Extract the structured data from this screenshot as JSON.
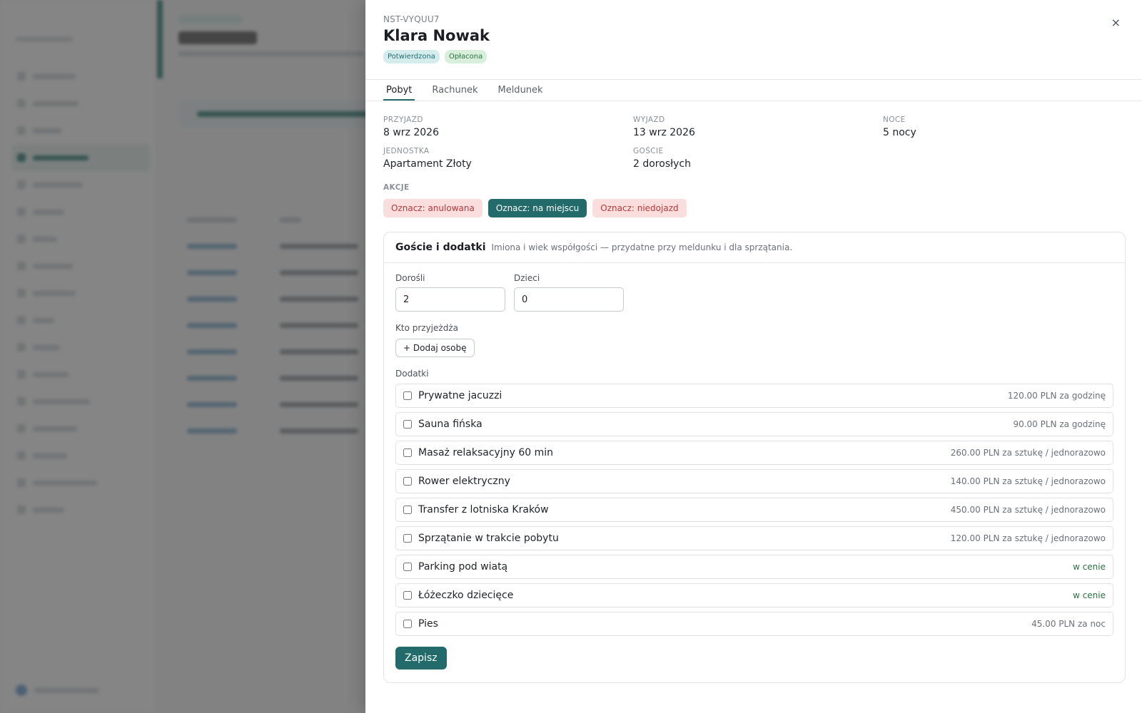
{
  "reservation": {
    "code": "NST-VYQUU7",
    "guest_name": "Klara Nowak",
    "badges": [
      "Potwierdzona",
      "Opłacona"
    ]
  },
  "tabs": [
    "Pobyt",
    "Rachunek",
    "Meldunek"
  ],
  "stay": {
    "arrival_label": "PRZYJAZD",
    "arrival_value": "8 wrz 2026",
    "departure_label": "WYJAZD",
    "departure_value": "13 wrz 2026",
    "nights_label": "NOCE",
    "nights_value": "5 nocy",
    "unit_label": "JEDNOSTKA",
    "unit_value": "Apartament Złoty",
    "guests_label": "GOŚCIE",
    "guests_value": "2 dorosłych"
  },
  "actions": {
    "label": "AKCJE",
    "cancel": "Oznacz: anulowana",
    "on_site": "Oznacz: na miejscu",
    "no_show": "Oznacz: niedojazd"
  },
  "guests_card": {
    "title": "Goście i dodatki",
    "subtitle": "Imiona i wiek współgości — przydatne przy meldunku i dla sprzątania.",
    "adults_label": "Dorośli",
    "adults_value": "2",
    "children_label": "Dzieci",
    "children_value": "0",
    "who_label": "Kto przyjeżdża",
    "add_person": "+ Dodaj osobę",
    "extras_label": "Dodatki",
    "extras": [
      {
        "name": "Prywatne jacuzzi",
        "price": "120.00 PLN za godzinę",
        "checked": false
      },
      {
        "name": "Sauna fińska",
        "price": "90.00 PLN za godzinę",
        "checked": false
      },
      {
        "name": "Masaż relaksacyjny 60 min",
        "price": "260.00 PLN za sztukę / jednorazowo",
        "checked": false
      },
      {
        "name": "Rower elektryczny",
        "price": "140.00 PLN za sztukę / jednorazowo",
        "checked": false
      },
      {
        "name": "Transfer z lotniska Kraków",
        "price": "450.00 PLN za sztukę / jednorazowo",
        "checked": false
      },
      {
        "name": "Sprzątanie w trakcie pobytu",
        "price": "120.00 PLN za sztukę / jednorazowo",
        "checked": false
      },
      {
        "name": "Parking pod wiatą",
        "price": "w cenie",
        "checked": false
      },
      {
        "name": "Łóżeczko dziecięce",
        "price": "w cenie",
        "checked": false
      },
      {
        "name": "Pies",
        "price": "45.00 PLN za noc",
        "checked": false
      }
    ],
    "save": "Zapisz"
  },
  "close_glyph": "×",
  "colors": {
    "accent": "#236b6b",
    "danger_bg": "#fadede",
    "danger_text": "#b23a3a"
  }
}
